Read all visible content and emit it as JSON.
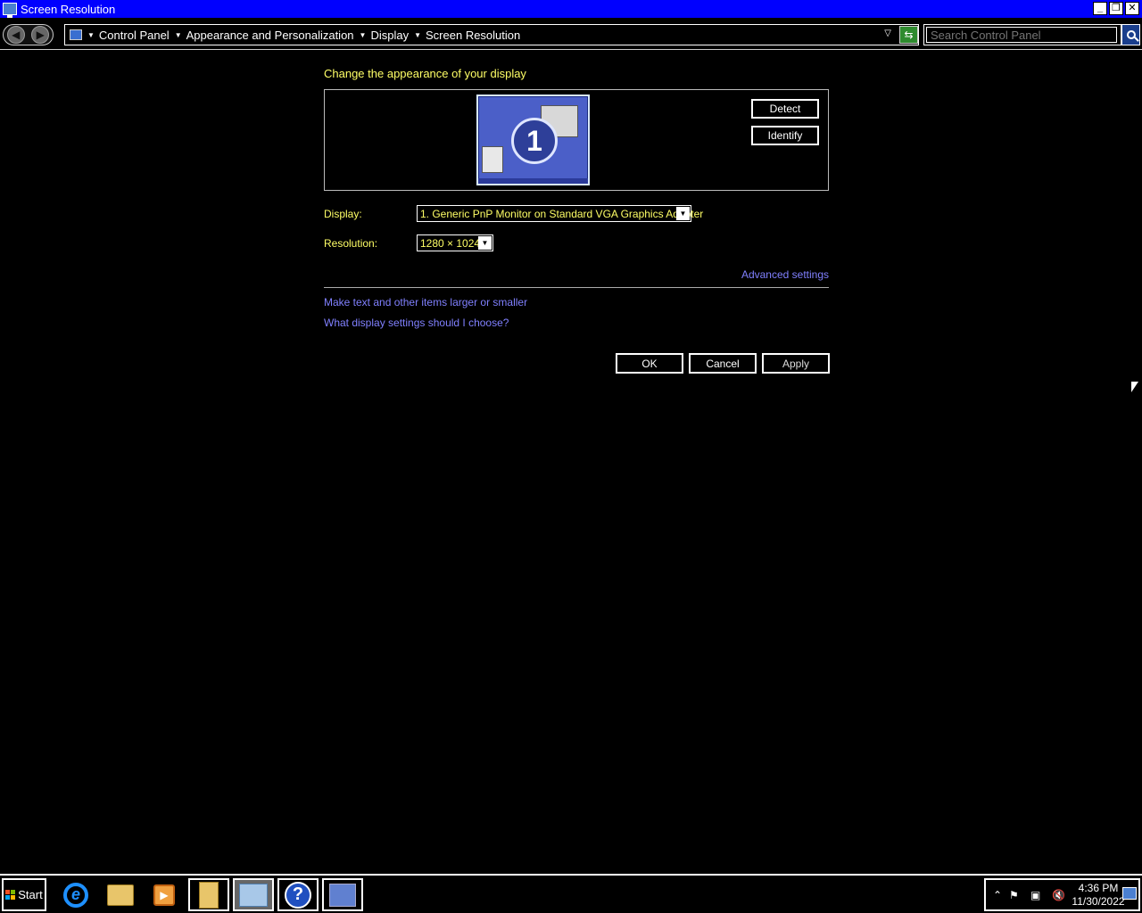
{
  "window": {
    "title": "Screen Resolution",
    "minimize": "_",
    "restore": "❐",
    "close": "✕"
  },
  "address": {
    "crumbs": [
      "Control Panel",
      "Appearance and Personalization",
      "Display",
      "Screen Resolution"
    ],
    "search_placeholder": "Search Control Panel"
  },
  "main": {
    "heading": "Change the appearance of your display",
    "monitor_number": "1",
    "detect_label": "Detect",
    "identify_label": "Identify",
    "display_label": "Display:",
    "display_value": "1. Generic PnP Monitor on Standard VGA Graphics Adapter",
    "resolution_label": "Resolution:",
    "resolution_value": "1280 × 1024",
    "advanced_link": "Advanced settings",
    "link_text_size": "Make text and other items larger or smaller",
    "link_help": "What display settings should I choose?",
    "ok_label": "OK",
    "cancel_label": "Cancel",
    "apply_label": "Apply"
  },
  "taskbar": {
    "start_label": "Start",
    "time": "4:36 PM",
    "date": "11/30/2022",
    "pinned": [
      "internet-explorer-icon",
      "file-explorer-icon",
      "media-player-icon",
      "documents-icon",
      "control-panel-icon",
      "help-icon",
      "network-icon"
    ]
  },
  "colors": {
    "titlebar": "#0000ff",
    "heading_text": "#ffff66",
    "link": "#8080ff",
    "background": "#000000"
  }
}
